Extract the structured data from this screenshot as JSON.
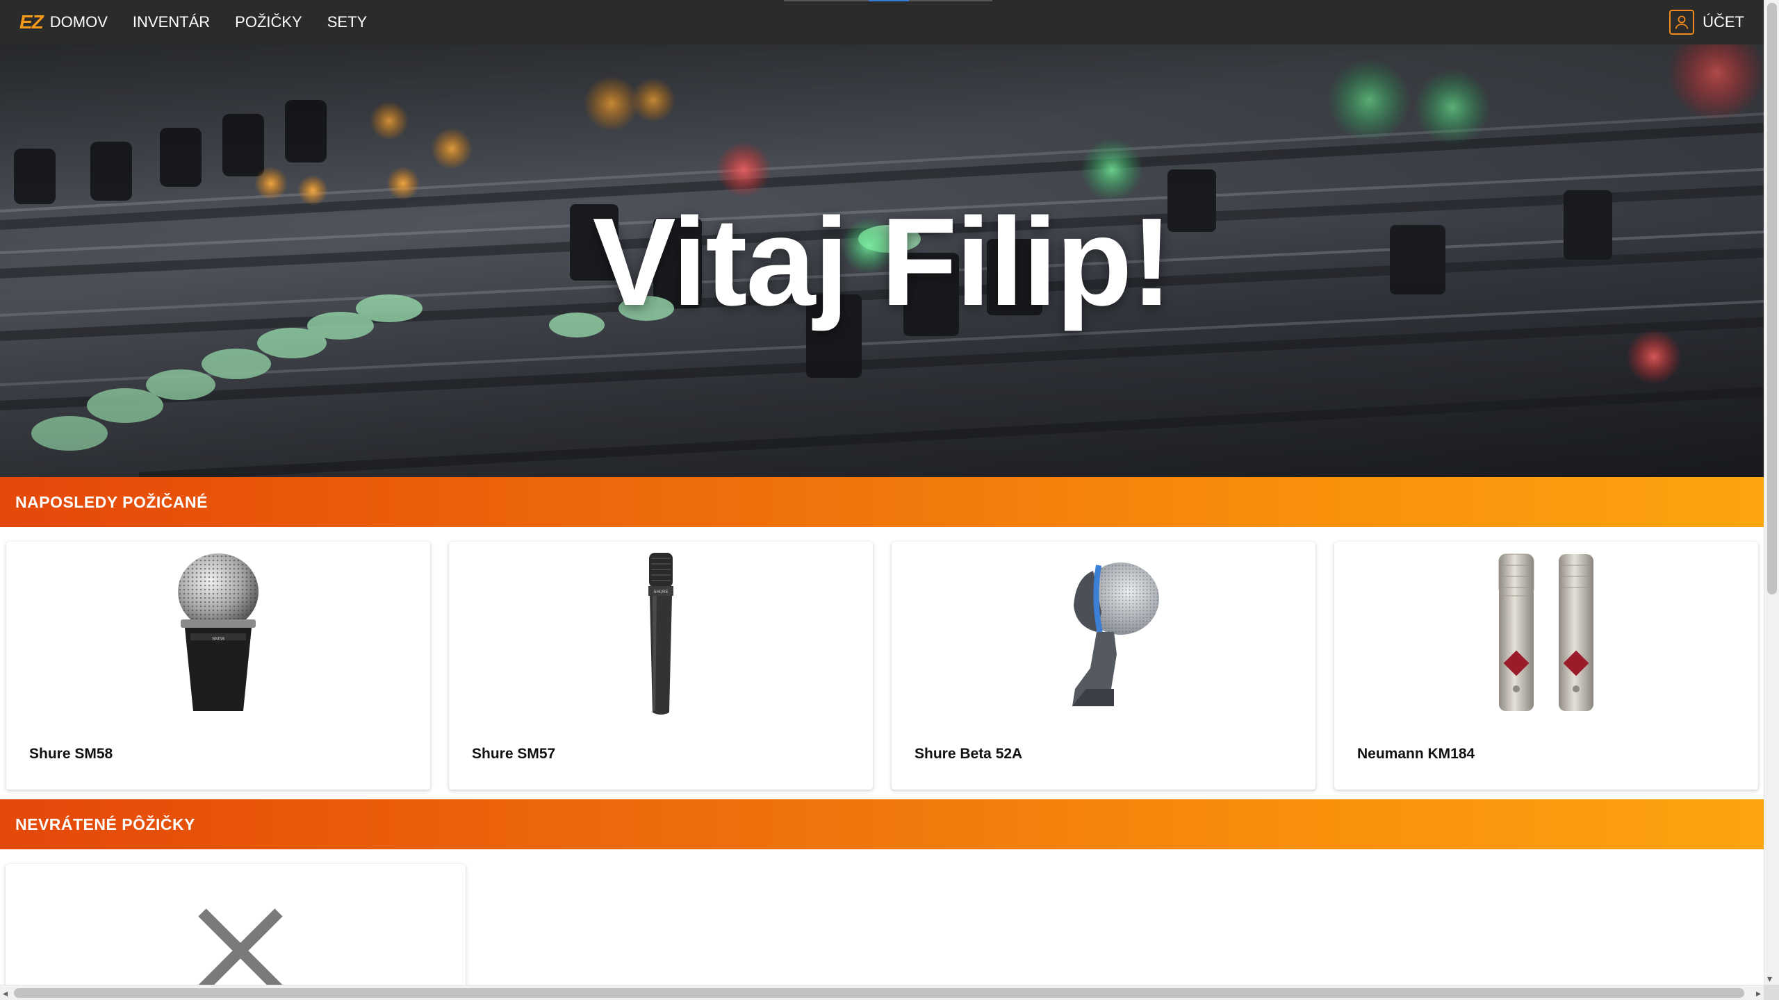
{
  "navbar": {
    "logo": "EZ",
    "items": [
      {
        "label": "DOMOV"
      },
      {
        "label": "INVENTÁR"
      },
      {
        "label": "POŽIČKY"
      },
      {
        "label": "SETY"
      }
    ],
    "account_label": "ÚČET"
  },
  "hero": {
    "title": "Vitaj Filip!"
  },
  "sections": {
    "recent": {
      "title": "NAPOSLEDY POŽIČANÉ",
      "items": [
        {
          "name": "Shure SM58",
          "icon": "microphone-sm58-image"
        },
        {
          "name": "Shure SM57",
          "icon": "microphone-sm57-image"
        },
        {
          "name": "Shure Beta 52A",
          "icon": "microphone-beta52a-image"
        },
        {
          "name": "Neumann KM184",
          "icon": "microphone-km184-pair-image"
        }
      ]
    },
    "unreturned": {
      "title": "NEVRÁTENÉ PÔŽIČKY",
      "empty_icon": "x-icon"
    }
  },
  "colors": {
    "navbar_bg": "#2b2b2b",
    "accent": "#f39a1a",
    "section_gradient_start": "#e4480a",
    "section_gradient_end": "#fda40f"
  }
}
